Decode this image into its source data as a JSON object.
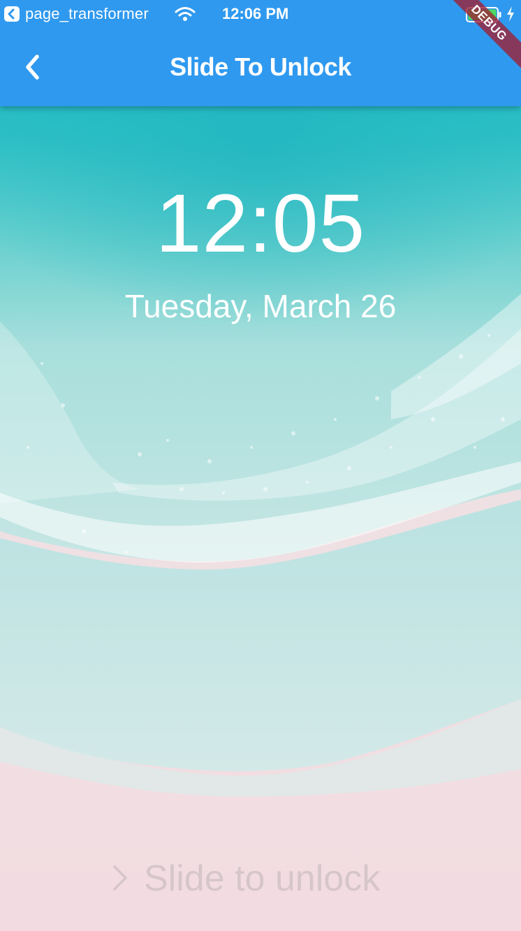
{
  "status_bar": {
    "app_name": "page_transformer",
    "time": "12:06 PM",
    "back_icon": "back-arrow-icon",
    "wifi_icon": "wifi-icon",
    "battery_icon": "battery-icon",
    "charging_icon": "charging-bolt-icon",
    "battery_color": "#4cd964"
  },
  "app_bar": {
    "title": "Slide To Unlock",
    "back_icon": "chevron-left-icon",
    "background": "#2f99ef"
  },
  "debug_banner": {
    "label": "DEBUG"
  },
  "lock_screen": {
    "time": "12:05",
    "date": "Tuesday, March 26",
    "unlock_icon": "chevron-right-icon",
    "unlock_label": "Slide to unlock"
  }
}
